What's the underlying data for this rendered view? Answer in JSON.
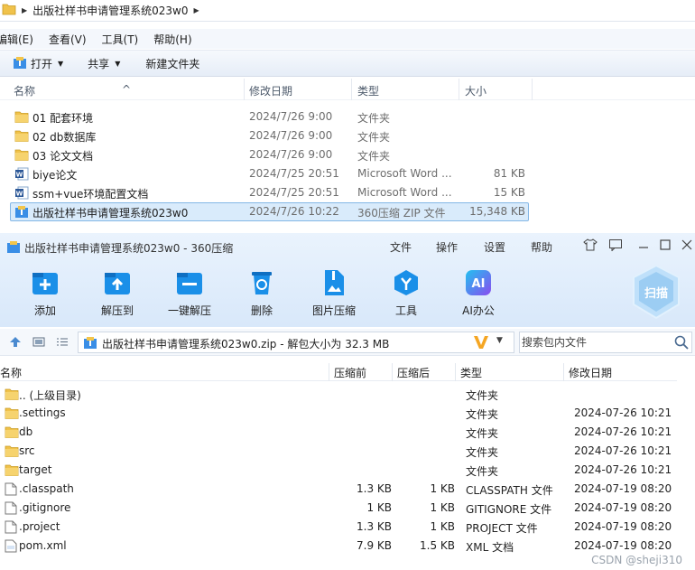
{
  "explorer": {
    "breadcrumb": "出版社样书申请管理系统023w0",
    "menu": [
      "编辑(E)",
      "查看(V)",
      "工具(T)",
      "帮助(H)"
    ],
    "commands": {
      "open": "打开",
      "share": "共享",
      "new_folder": "新建文件夹"
    },
    "columns": {
      "name": "名称",
      "date": "修改日期",
      "type": "类型",
      "size": "大小"
    },
    "rows": [
      {
        "name": "01 配套环境",
        "date": "2024/7/26 9:00",
        "type": "文件夹",
        "size": "",
        "icon": "folder-icon"
      },
      {
        "name": "02 db数据库",
        "date": "2024/7/26 9:00",
        "type": "文件夹",
        "size": "",
        "icon": "folder-icon"
      },
      {
        "name": "03 论文文档",
        "date": "2024/7/26 9:00",
        "type": "文件夹",
        "size": "",
        "icon": "folder-icon"
      },
      {
        "name": "biye论文",
        "date": "2024/7/25 20:51",
        "type": "Microsoft Word ...",
        "size": "81 KB",
        "icon": "word-doc-icon"
      },
      {
        "name": "ssm+vue环境配置文档",
        "date": "2024/7/25 20:51",
        "type": "Microsoft Word ...",
        "size": "15 KB",
        "icon": "word-doc-icon"
      },
      {
        "name": "出版社样书申请管理系统023w0",
        "date": "2024/7/26 10:22",
        "type": "360压缩 ZIP 文件",
        "size": "15,348 KB",
        "icon": "zip-archive-icon",
        "selected": true
      }
    ]
  },
  "zip_window": {
    "title": "出版社样书申请管理系统023w0 - 360压缩",
    "menu": [
      "文件",
      "操作",
      "设置",
      "帮助"
    ],
    "tools": [
      {
        "label": "添加",
        "icon": "add-icon"
      },
      {
        "label": "解压到",
        "icon": "extract-to-icon"
      },
      {
        "label": "一键解压",
        "icon": "one-click-extract-icon"
      },
      {
        "label": "删除",
        "icon": "recycle-bin-icon"
      },
      {
        "label": "图片压缩",
        "icon": "image-compress-icon"
      },
      {
        "label": "工具",
        "icon": "tools-icon"
      },
      {
        "label": "AI办公",
        "icon": "ai-office-icon"
      }
    ],
    "scan_label": "扫描",
    "path": "出版社样书申请管理系统023w0.zip - 解包大小为 32.3 MB",
    "search_placeholder": "搜索包内文件",
    "columns": {
      "name": "名称",
      "compressed_before": "压缩前",
      "compressed_after": "压缩后",
      "type": "类型",
      "date": "修改日期"
    },
    "rows": [
      {
        "name": ".. (上级目录)",
        "before": "",
        "after": "",
        "type": "文件夹",
        "date": "",
        "icon": "folder-icon"
      },
      {
        "name": ".settings",
        "before": "",
        "after": "",
        "type": "文件夹",
        "date": "2024-07-26 10:21",
        "icon": "folder-icon"
      },
      {
        "name": "db",
        "before": "",
        "after": "",
        "type": "文件夹",
        "date": "2024-07-26 10:21",
        "icon": "folder-icon"
      },
      {
        "name": "src",
        "before": "",
        "after": "",
        "type": "文件夹",
        "date": "2024-07-26 10:21",
        "icon": "folder-icon"
      },
      {
        "name": "target",
        "before": "",
        "after": "",
        "type": "文件夹",
        "date": "2024-07-26 10:21",
        "icon": "folder-icon"
      },
      {
        "name": ".classpath",
        "before": "1.3 KB",
        "after": "1 KB",
        "type": "CLASSPATH 文件",
        "date": "2024-07-19 08:20",
        "icon": "file-icon"
      },
      {
        "name": ".gitignore",
        "before": "1 KB",
        "after": "1 KB",
        "type": "GITIGNORE 文件",
        "date": "2024-07-19 08:20",
        "icon": "file-icon"
      },
      {
        "name": ".project",
        "before": "1.3 KB",
        "after": "1 KB",
        "type": "PROJECT 文件",
        "date": "2024-07-19 08:20",
        "icon": "file-icon"
      },
      {
        "name": "pom.xml",
        "before": "7.9 KB",
        "after": "1.5 KB",
        "type": "XML 文档",
        "date": "2024-07-19 08:20",
        "icon": "xml-file-icon"
      }
    ]
  },
  "watermark": "CSDN @sheji310",
  "colors": {
    "accent": "#1a8fe8",
    "selection": "#d9ebfb",
    "folder": "#f0c24b"
  }
}
